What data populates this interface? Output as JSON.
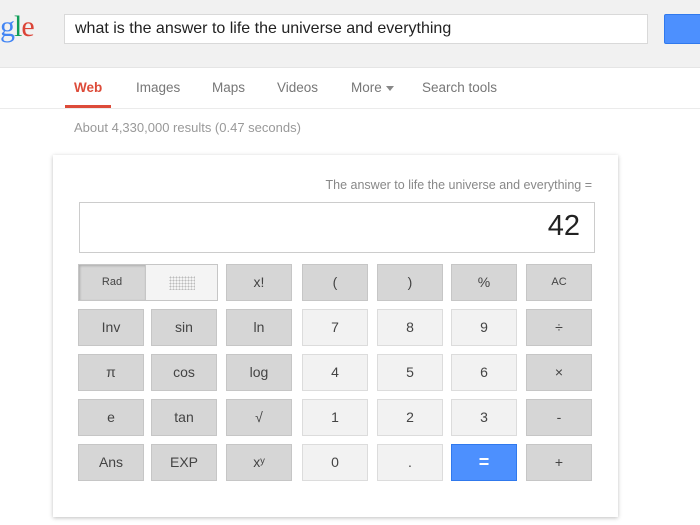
{
  "header": {
    "logo": "ogle",
    "query": "what is the answer to life the universe and everything"
  },
  "nav": {
    "tabs": [
      "Web",
      "Images",
      "Maps",
      "Videos",
      "More",
      "Search tools"
    ],
    "active": "Web"
  },
  "stats": "About 4,330,000 results (0.47 seconds)",
  "calculator": {
    "expression": "The answer to life the universe and everything =",
    "result": "42",
    "mode": "Rad",
    "keys": [
      [
        "x!",
        "(",
        ")",
        "%",
        "AC"
      ],
      [
        "Inv",
        "sin",
        "ln",
        "7",
        "8",
        "9",
        "÷"
      ],
      [
        "π",
        "cos",
        "log",
        "4",
        "5",
        "6",
        "×"
      ],
      [
        "e",
        "tan",
        "√",
        "1",
        "2",
        "3",
        "-"
      ],
      [
        "Ans",
        "EXP",
        "xʸ",
        "0",
        ".",
        "=",
        "+"
      ]
    ]
  },
  "colors": {
    "accent": "#4d90fe",
    "active_tab": "#dd4b39"
  }
}
